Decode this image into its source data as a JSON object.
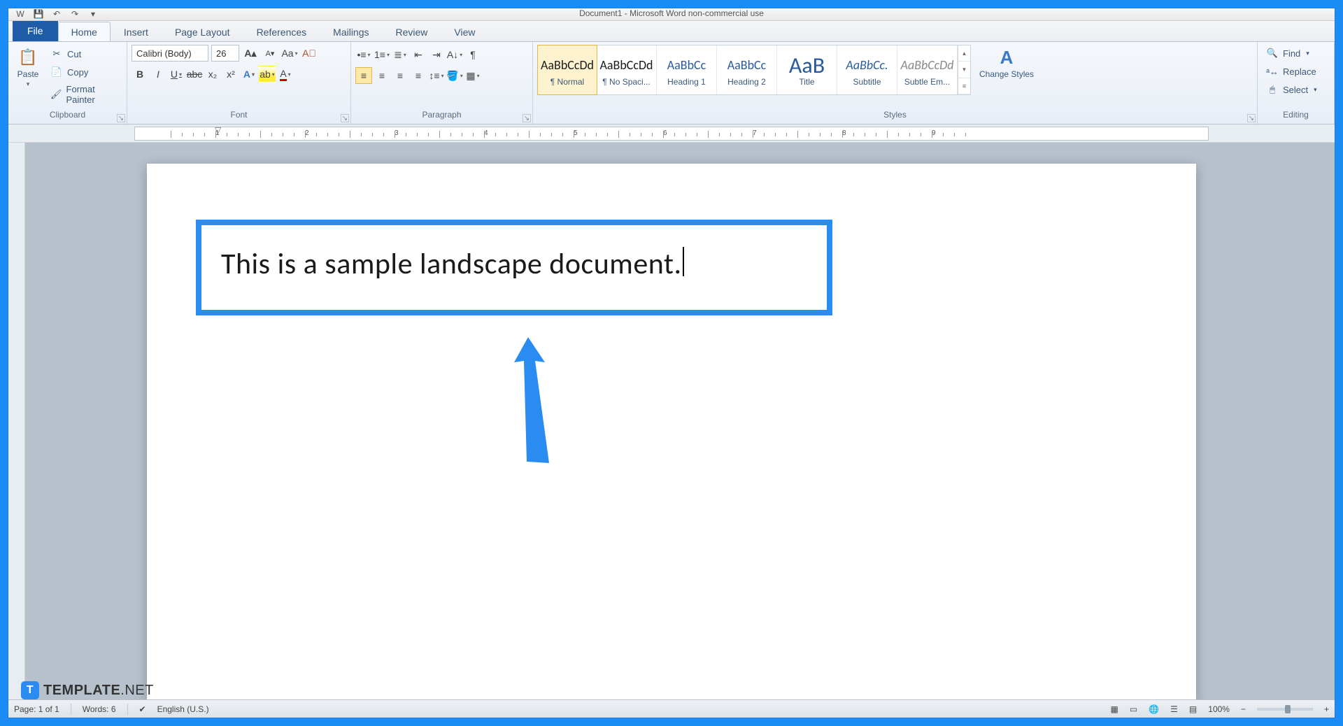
{
  "title": "Document1 - Microsoft Word non-commercial use",
  "tabs": {
    "file": "File",
    "items": [
      "Home",
      "Insert",
      "Page Layout",
      "References",
      "Mailings",
      "Review",
      "View"
    ],
    "active": "Home"
  },
  "clipboard": {
    "paste": "Paste",
    "cut": "Cut",
    "copy": "Copy",
    "format_painter": "Format Painter",
    "label": "Clipboard"
  },
  "font": {
    "name": "Calibri (Body)",
    "size": "26",
    "label": "Font"
  },
  "paragraph": {
    "label": "Paragraph"
  },
  "styles": {
    "label": "Styles",
    "change": "Change Styles",
    "items": [
      {
        "preview": "AaBbCcDd",
        "name": "¶ Normal",
        "sel": true,
        "cls": ""
      },
      {
        "preview": "AaBbCcDd",
        "name": "¶ No Spaci...",
        "sel": false,
        "cls": ""
      },
      {
        "preview": "AaBbCc",
        "name": "Heading 1",
        "sel": false,
        "cls": "blue"
      },
      {
        "preview": "AaBbCc",
        "name": "Heading 2",
        "sel": false,
        "cls": "blue"
      },
      {
        "preview": "AaB",
        "name": "Title",
        "sel": false,
        "cls": "blue big"
      },
      {
        "preview": "AaBbCc.",
        "name": "Subtitle",
        "sel": false,
        "cls": "blue"
      },
      {
        "preview": "AaBbCcDd",
        "name": "Subtle Em...",
        "sel": false,
        "cls": ""
      }
    ]
  },
  "editing": {
    "label": "Editing",
    "find": "Find",
    "replace": "Replace",
    "select": "Select"
  },
  "document": {
    "text": "This is a sample landscape document."
  },
  "statusbar": {
    "page": "Page: 1 of 1",
    "words": "Words: 6",
    "lang": "English (U.S.)",
    "zoom": "100%"
  },
  "watermark": {
    "brand": "TEMPLATE",
    "suffix": ".NET"
  },
  "ruler_nums": [
    "1",
    "2",
    "3",
    "4",
    "5",
    "6",
    "7",
    "8",
    "9"
  ]
}
